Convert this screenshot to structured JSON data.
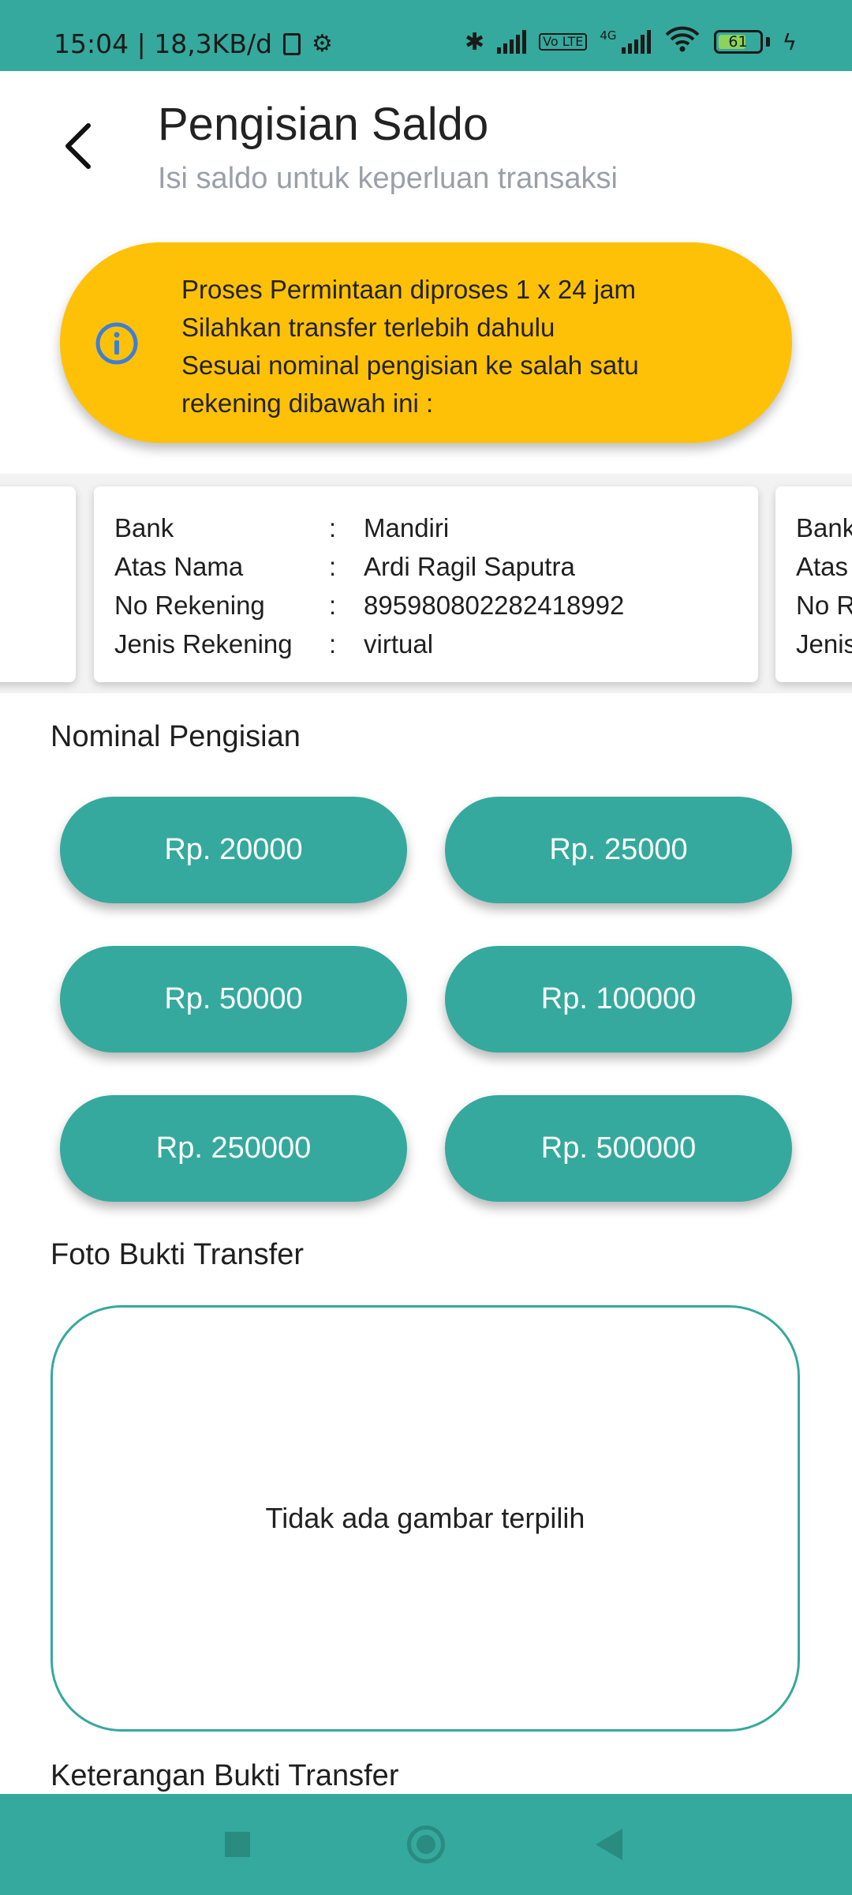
{
  "status_bar": {
    "time_info": "15:04 | 18,3KB/d",
    "network_badge": "Vo LTE",
    "network_type": "4G",
    "battery": "61"
  },
  "header": {
    "title": "Pengisian Saldo",
    "subtitle": "Isi saldo untuk keperluan transaksi"
  },
  "info_banner": {
    "lines": [
      "Proses Permintaan diproses 1 x 24 jam",
      "Silahkan transfer terlebih dahulu",
      "Sesuai nominal pengisian ke salah satu",
      "rekening dibawah ini :"
    ]
  },
  "bank_card": {
    "rows": [
      {
        "label": "Bank",
        "sep": ":",
        "value": "Mandiri"
      },
      {
        "label": "Atas Nama",
        "sep": ":",
        "value": "Ardi Ragil Saputra"
      },
      {
        "label": "No Rekening",
        "sep": ":",
        "value": "895980802282418992"
      },
      {
        "label": "Jenis Rekening",
        "sep": ":",
        "value": "virtual"
      }
    ],
    "next_card_labels": [
      "Bank",
      "Atas",
      "No R",
      "Jenis"
    ]
  },
  "nominal": {
    "label": "Nominal Pengisian",
    "options": [
      "Rp. 20000",
      "Rp. 25000",
      "Rp. 50000",
      "Rp. 100000",
      "Rp. 250000",
      "Rp. 500000"
    ]
  },
  "photo": {
    "label": "Foto Bukti Transfer",
    "empty_text": "Tidak ada gambar terpilih"
  },
  "description": {
    "label": "Keterangan Bukti Transfer"
  },
  "colors": {
    "primary": "#35a99d",
    "banner": "#ffc107",
    "info_icon": "#3d7fd6"
  }
}
